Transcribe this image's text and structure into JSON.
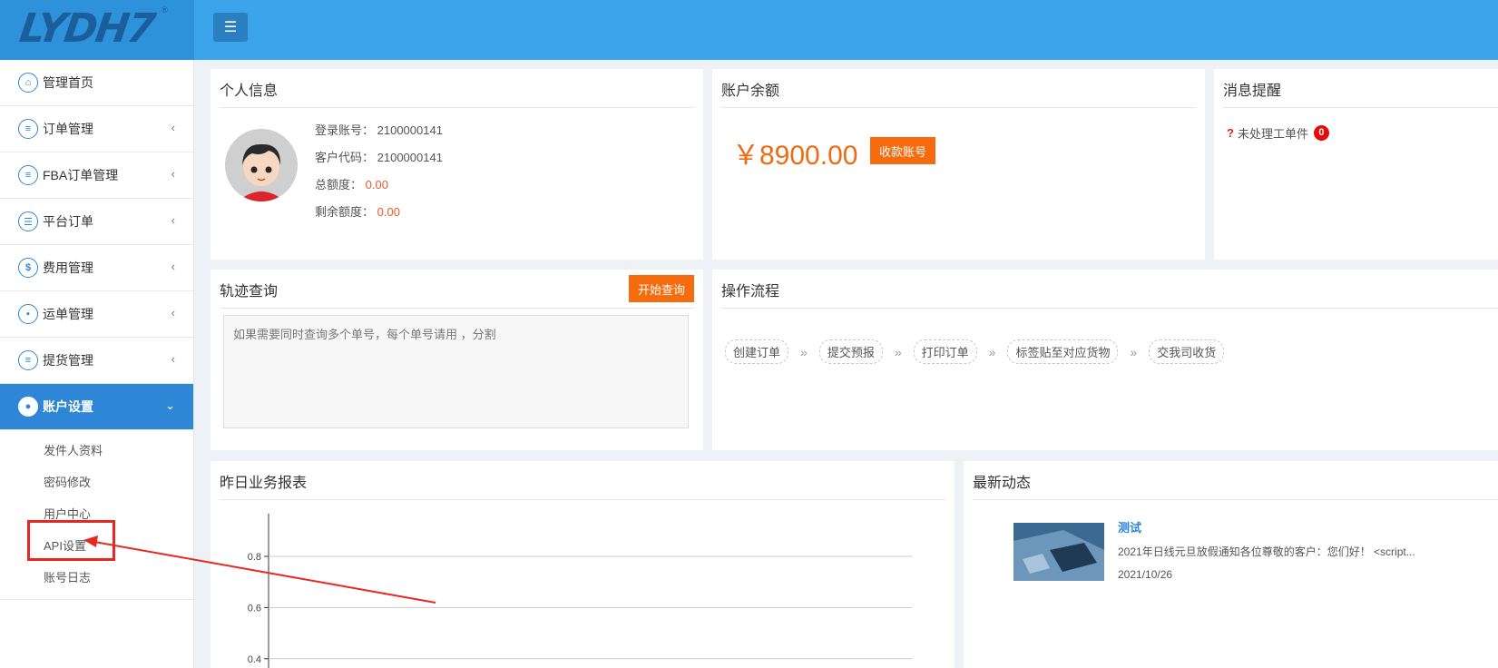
{
  "header": {
    "logo_text": "LYDH7",
    "logo_reg": "®",
    "menu_toggle_icon": "hamburger-icon"
  },
  "sidebar": {
    "items": [
      {
        "label": "管理首页",
        "icon": "home-icon",
        "chevron": ""
      },
      {
        "label": "订单管理",
        "icon": "document-icon",
        "chevron": "‹"
      },
      {
        "label": "FBA订单管理",
        "icon": "document-icon",
        "chevron": "‹"
      },
      {
        "label": "平台订单",
        "icon": "list-icon",
        "chevron": "‹"
      },
      {
        "label": "费用管理",
        "icon": "dollar-icon",
        "chevron": "‹"
      },
      {
        "label": "运单管理",
        "icon": "truck-icon",
        "chevron": "‹"
      },
      {
        "label": "提货管理",
        "icon": "document-icon",
        "chevron": "‹"
      },
      {
        "label": "账户设置",
        "icon": "user-icon",
        "chevron": "⌄",
        "active": true
      }
    ],
    "sub_items": [
      "发件人资料",
      "密码修改",
      "用户中心",
      "API设置",
      "账号日志"
    ]
  },
  "personal_info": {
    "title": "个人信息",
    "login_label": "登录账号：",
    "login_value": "2100000141",
    "customer_label": "客户代码：",
    "customer_value": "2100000141",
    "total_label": "总额度：",
    "total_value": "0.00",
    "remain_label": "剩余额度：",
    "remain_value": "0.00"
  },
  "balance": {
    "title": "账户余额",
    "amount": "￥8900.00",
    "button": "收款账号"
  },
  "messages": {
    "title": "消息提醒",
    "item_label": "未处理工单件",
    "item_count": "0"
  },
  "tracking": {
    "title": "轨迹查询",
    "button": "开始查询",
    "placeholder": "如果需要同时查询多个单号，每个单号请用 ，分割"
  },
  "flow": {
    "title": "操作流程",
    "steps": [
      "创建订单",
      "提交预报",
      "打印订单",
      "标签贴至对应货物",
      "交我司收货"
    ],
    "arrow": "»"
  },
  "report": {
    "title": "昨日业务报表"
  },
  "chart_data": {
    "type": "line",
    "title": "",
    "xlabel": "",
    "ylabel": "",
    "ylim": [
      0.3,
      1.0
    ],
    "yticks": [
      0.8,
      0.6,
      0.4
    ],
    "series": [],
    "grid": true
  },
  "news": {
    "title": "最新动态",
    "item_title": "测试",
    "item_desc": "2021年日线元旦放假通知各位尊敬的客户：您们好！ <script...",
    "item_date": "2021/10/26"
  },
  "colors": {
    "topbar": "#3ba4ea",
    "active_nav": "#2e86d6",
    "orange": "#f66b0e",
    "annotation_red": "#e8281e"
  }
}
